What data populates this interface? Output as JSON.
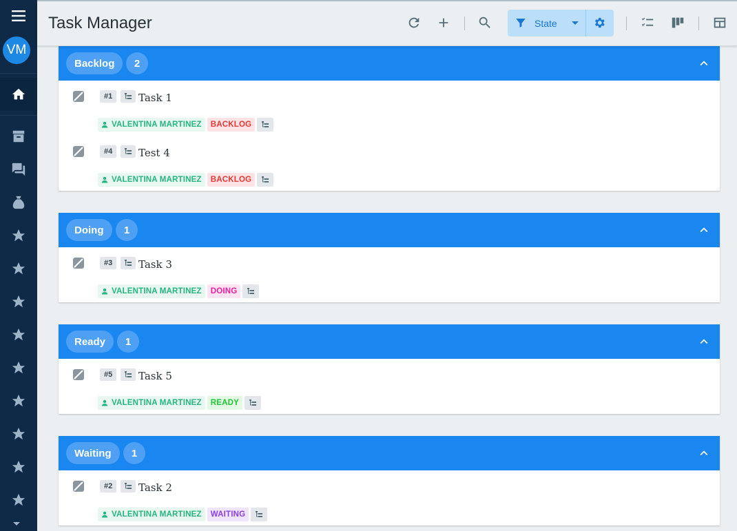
{
  "app": {
    "title": "Task Manager"
  },
  "sidebar": {
    "avatar_initials": "VM",
    "items": [
      {
        "icon": "home-icon",
        "active": true
      },
      {
        "icon": "archive-icon"
      },
      {
        "icon": "forum-icon"
      },
      {
        "icon": "bag-icon"
      },
      {
        "icon": "star-icon"
      },
      {
        "icon": "star-icon"
      },
      {
        "icon": "star-icon"
      },
      {
        "icon": "star-icon"
      },
      {
        "icon": "star-icon"
      },
      {
        "icon": "star-icon"
      },
      {
        "icon": "star-icon"
      },
      {
        "icon": "star-icon"
      },
      {
        "icon": "star-icon"
      }
    ]
  },
  "toolbar": {
    "filter_label": "State",
    "icons": [
      "refresh-icon",
      "add-icon",
      "search-icon",
      "filter-icon",
      "gear-icon",
      "checklist-icon",
      "board-icon",
      "table-icon"
    ]
  },
  "groups": [
    {
      "name": "Backlog",
      "count": "2",
      "state_tag": "BACKLOG",
      "color": "#1a86f0",
      "tasks": [
        {
          "id": "#1",
          "title": "Task 1",
          "assignee": "VALENTINA MARTINEZ",
          "state": "BACKLOG"
        },
        {
          "id": "#4",
          "title": "Test 4",
          "assignee": "VALENTINA MARTINEZ",
          "state": "BACKLOG"
        }
      ]
    },
    {
      "name": "Doing",
      "count": "1",
      "state_tag": "DOING",
      "tasks": [
        {
          "id": "#3",
          "title": "Task 3",
          "assignee": "VALENTINA MARTINEZ",
          "state": "DOING"
        }
      ]
    },
    {
      "name": "Ready",
      "count": "1",
      "state_tag": "READY",
      "tasks": [
        {
          "id": "#5",
          "title": "Task 5",
          "assignee": "VALENTINA MARTINEZ",
          "state": "READY"
        }
      ]
    },
    {
      "name": "Waiting",
      "count": "1",
      "state_tag": "WAITING",
      "tasks": [
        {
          "id": "#2",
          "title": "Task 2",
          "assignee": "VALENTINA MARTINEZ",
          "state": "WAITING"
        }
      ]
    }
  ]
}
